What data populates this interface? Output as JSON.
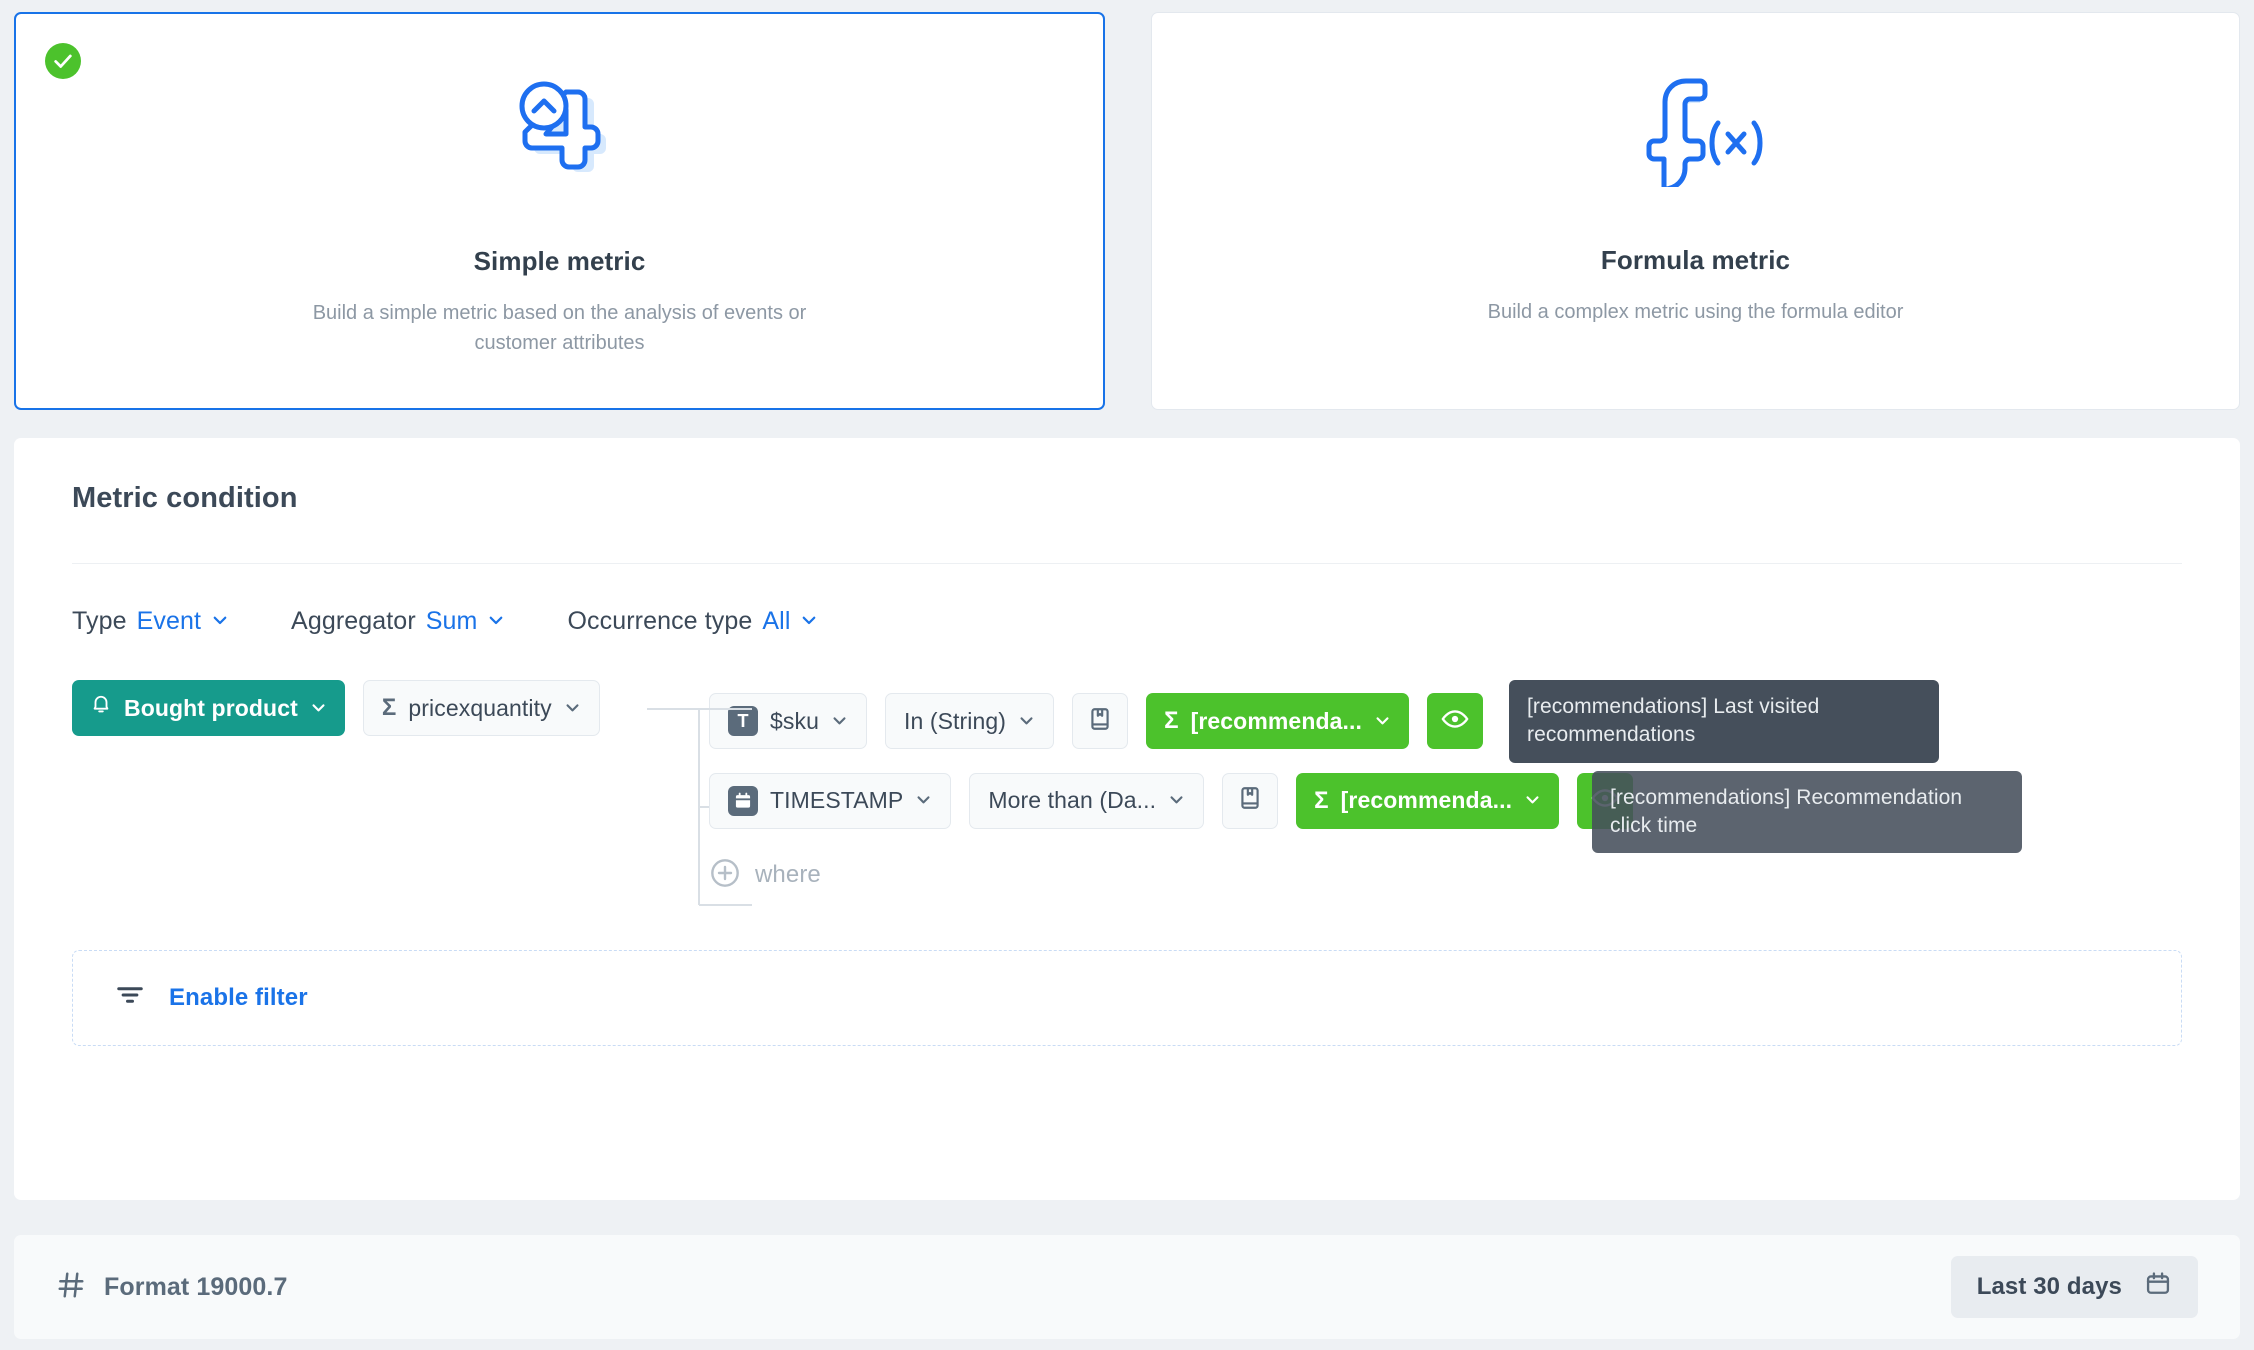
{
  "cards": [
    {
      "id": "simple-metric",
      "title": "Simple metric",
      "desc": "Build a simple metric based on the analysis of events or customer attributes",
      "selected": true,
      "icon": "number-four-chevron-icon"
    },
    {
      "id": "formula-metric",
      "title": "Formula metric",
      "desc": "Build a complex metric using the formula editor",
      "selected": false,
      "icon": "function-fx-icon"
    }
  ],
  "panel": {
    "title": "Metric condition",
    "selectors": [
      {
        "label": "Type",
        "value": "Event"
      },
      {
        "label": "Aggregator",
        "value": "Sum"
      },
      {
        "label": "Occurrence type",
        "value": "All"
      }
    ],
    "event_chip": "Bought product",
    "property_chip": "pricexquantity",
    "conditions": [
      {
        "attribute": "$sku",
        "attribute_icon": "text-type-icon",
        "operator": "In (String)",
        "book_icon": "book-icon",
        "value_chip": "[recommenda...",
        "eye_icon": "eye-icon",
        "tooltip": "[recommendations] Last visited recommendations"
      },
      {
        "attribute": "TIMESTAMP",
        "attribute_icon": "calendar-type-icon",
        "operator": "More than (Da...",
        "book_icon": "book-icon",
        "value_chip": "[recommenda...",
        "eye_icon": "eye-icon",
        "tooltip": "[recommendations] Recommendation click time"
      }
    ],
    "where_label": "where",
    "filter_label": "Enable filter"
  },
  "bottom": {
    "format_label": "Format 19000.7",
    "date_range": "Last 30 days"
  },
  "colors": {
    "accent_blue": "#1a73e8",
    "teal": "#169b8c",
    "green": "#4cc22c",
    "tooltip_bg": "#454f5b"
  }
}
